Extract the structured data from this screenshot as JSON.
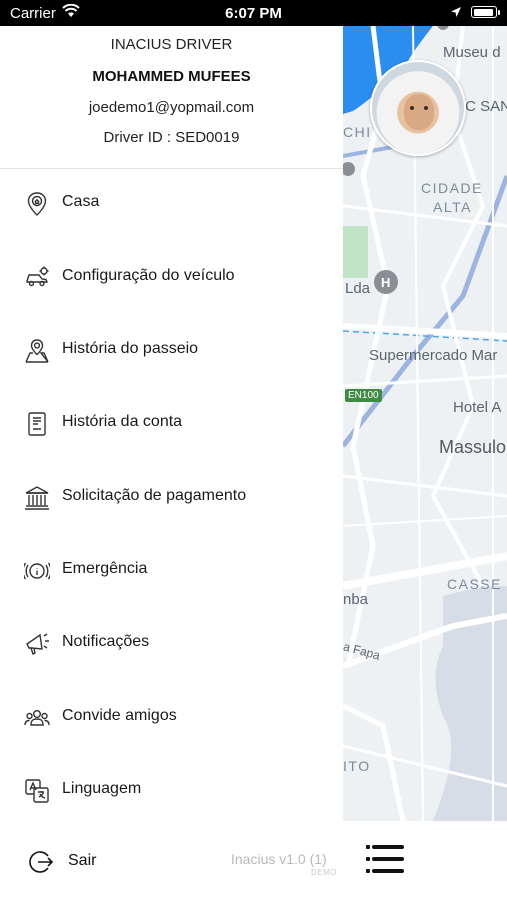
{
  "status_bar": {
    "carrier": "Carrier",
    "time": "6:07 PM"
  },
  "drawer": {
    "app_name": "INACIUS DRIVER",
    "driver_name": "MOHAMMED MUFEES",
    "email": "joedemo1@yopmail.com",
    "driver_id": "Driver ID : SED0019",
    "menu": [
      {
        "label": "Casa",
        "icon": "home-pin-icon"
      },
      {
        "label": "Configuração do veículo",
        "icon": "vehicle-settings-icon"
      },
      {
        "label": "História do passeio",
        "icon": "ride-history-map-icon"
      },
      {
        "label": "História da conta",
        "icon": "account-history-receipt-icon"
      },
      {
        "label": "Solicitação de pagamento",
        "icon": "bank-icon"
      },
      {
        "label": "Emergência",
        "icon": "emergency-info-icon"
      },
      {
        "label": "Notificações",
        "icon": "megaphone-icon"
      },
      {
        "label": "Convide amigos",
        "icon": "group-users-icon"
      },
      {
        "label": "Linguagem",
        "icon": "translate-icon"
      }
    ]
  },
  "footer": {
    "logout_label": "Sair",
    "version": "Inacius v1.0 (1)",
    "build_tag": "DEMO"
  },
  "map": {
    "labels": {
      "museu": "Museu d",
      "ic_san": "IC SAN",
      "chi": "CHI",
      "cidade": "CIDADE",
      "alta": "ALTA",
      "lda": "Lda",
      "supermercado": "Supermercado Mar",
      "road_code": "EN100",
      "hotel": "Hotel A",
      "massulo": "Massulo",
      "casse": "CASSE",
      "nba": "nba",
      "fapa": "a Fapa",
      "ito": "ITO"
    }
  }
}
